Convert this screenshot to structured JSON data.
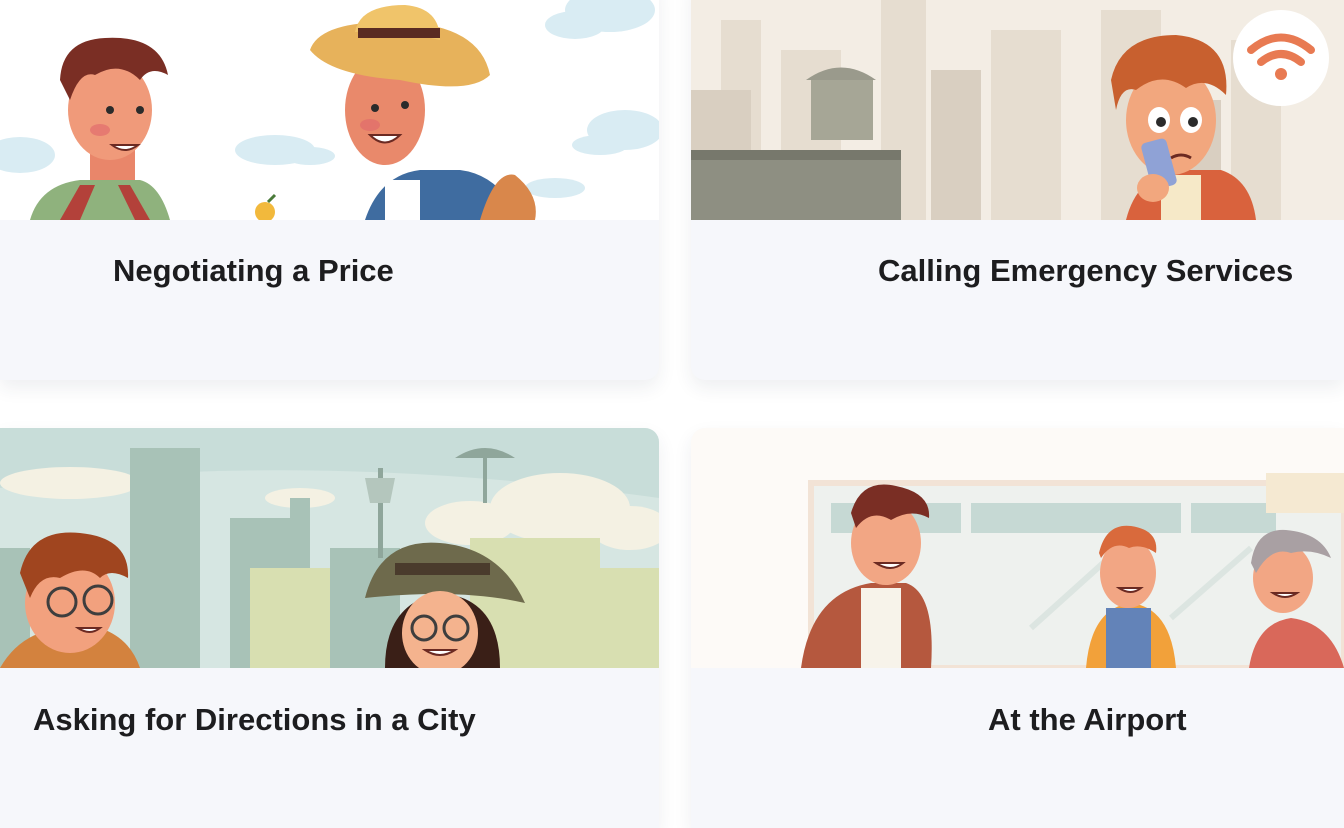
{
  "cards": [
    {
      "title": "Negotiating a Price"
    },
    {
      "title": "Calling Emergency Services"
    },
    {
      "title": "Asking for Directions in a City"
    },
    {
      "title": "At the Airport"
    }
  ],
  "colors": {
    "card_background": "#f6f7fb",
    "title_text": "#1d1d1f",
    "page_background": "#ffffff"
  },
  "icons": [
    "wifi-signal-icon"
  ]
}
